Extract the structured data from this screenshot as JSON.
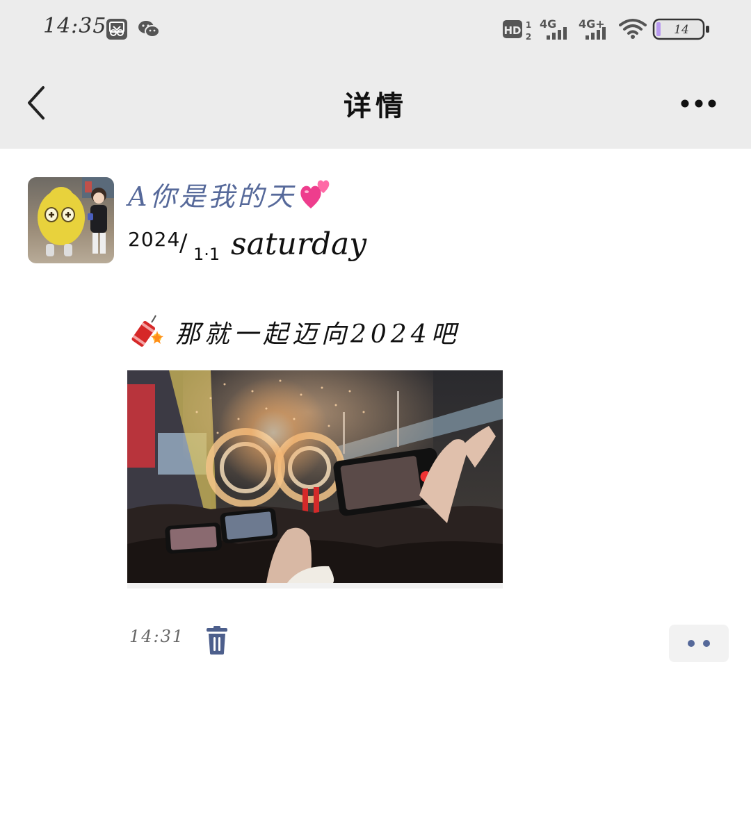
{
  "status_bar": {
    "time": "14:35",
    "battery": "14",
    "network_1": "4G",
    "network_2": "4G+",
    "hd_label": "HD",
    "icons": [
      "gallery-icon",
      "wechat-icon",
      "hd-voice-icon",
      "signal-4g-icon",
      "signal-4g-plus-icon",
      "wifi-icon",
      "battery-icon"
    ]
  },
  "nav": {
    "title": "详情",
    "back_icon": "chevron-left-icon",
    "more_icon": "more-dots-icon"
  },
  "post": {
    "username": "A你是我的天",
    "username_emoji": "two-hearts-icon",
    "date": {
      "year": "2024",
      "slash": "/",
      "day": "1·1",
      "weekday": "saturday"
    },
    "text": "那就一起迈向2024吧",
    "text_emoji": "firecracker-icon",
    "image": "fireworks-crowd-photo",
    "time": "14:31",
    "actions": [
      "delete-icon",
      "more-dots-icon"
    ]
  },
  "colors": {
    "header_bg": "#ececec",
    "username": "#56699a",
    "icon_blue": "#4d5f8c",
    "action_bg": "#f2f2f2"
  }
}
